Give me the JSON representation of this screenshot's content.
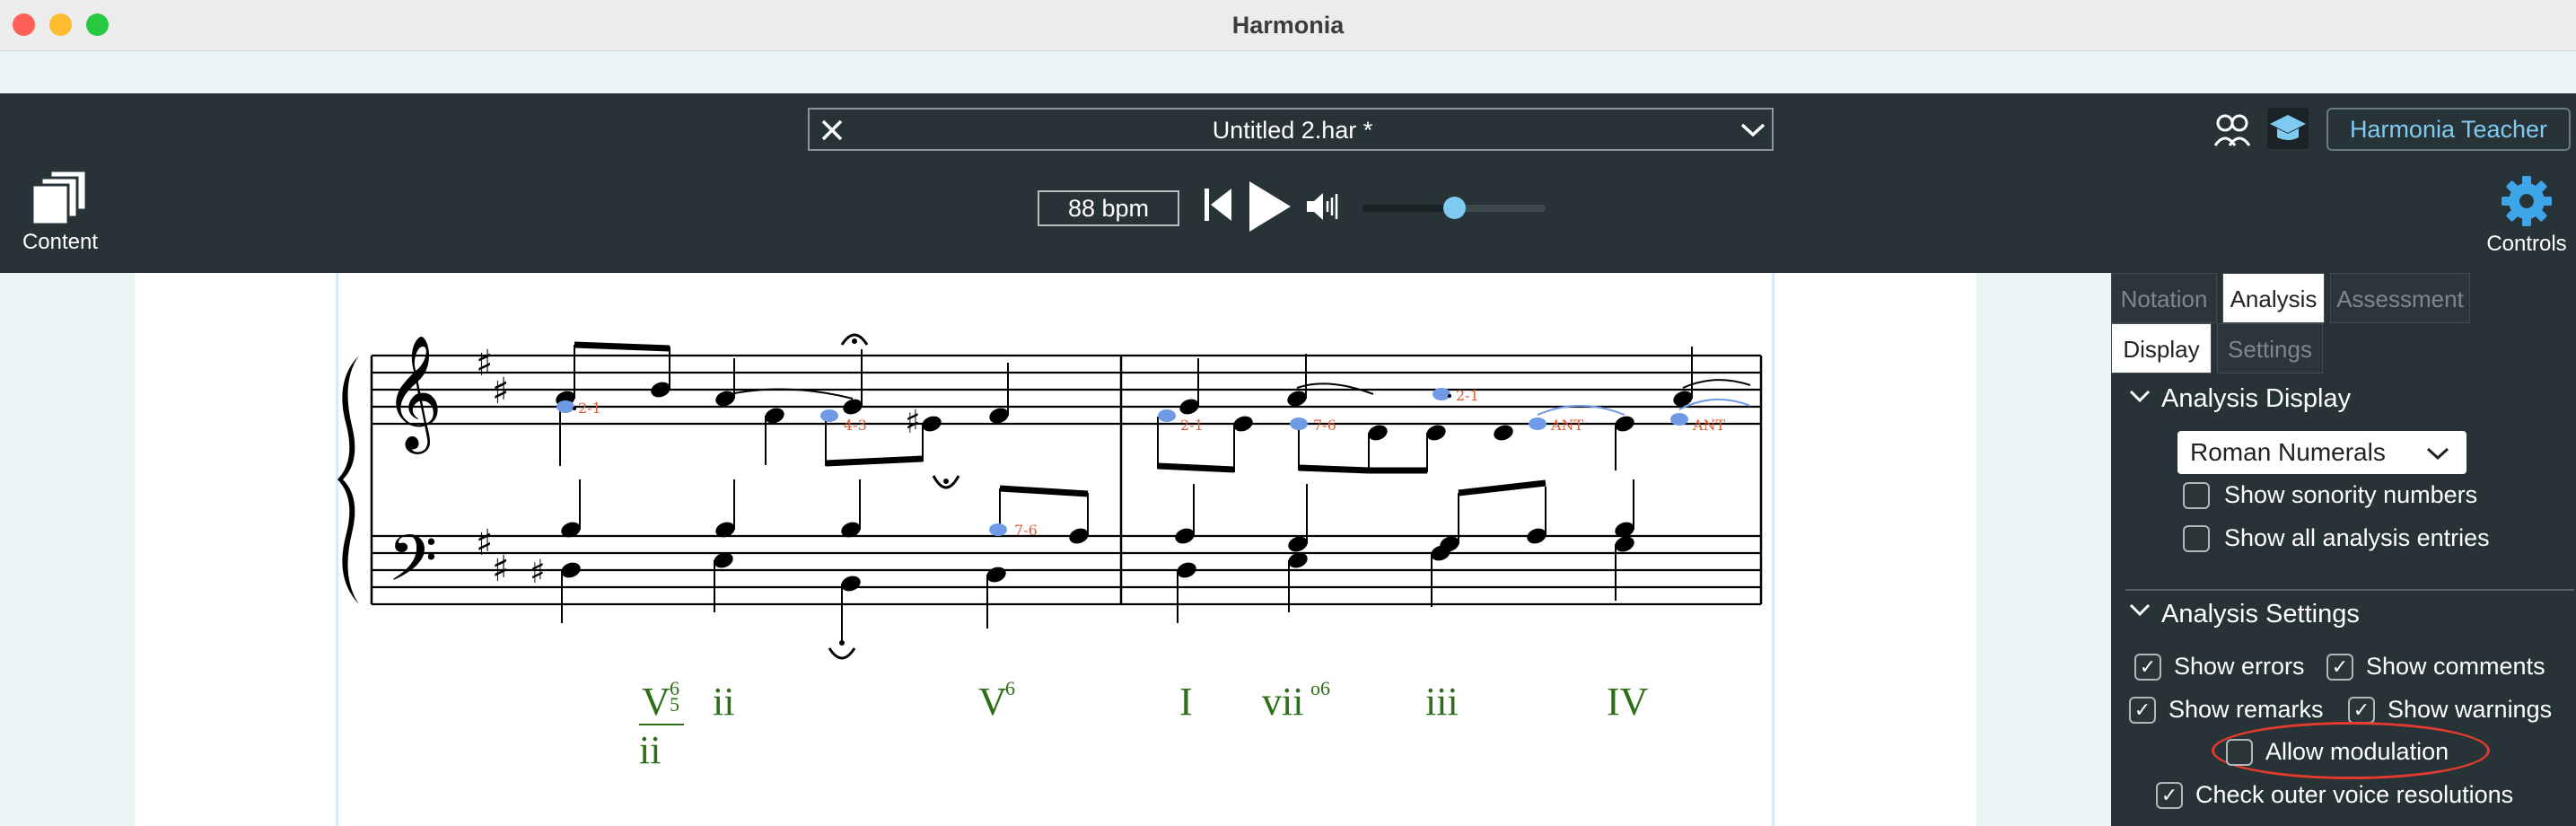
{
  "window": {
    "title": "Harmonia"
  },
  "toolbar": {
    "file_name": "Untitled 2.har *",
    "tempo": "88 bpm",
    "volume_level": 0.5,
    "content_label": "Content",
    "controls_label": "Controls",
    "teacher_label": "Harmonia Teacher"
  },
  "panel": {
    "tabs": [
      "Notation",
      "Analysis",
      "Assessment"
    ],
    "subtabs": [
      "Display",
      "Settings"
    ],
    "display_section_title": "Analysis Display",
    "dropdown_value": "Roman Numerals",
    "display_options": [
      {
        "label": "Show sonority numbers",
        "checked": false
      },
      {
        "label": "Show all analysis entries",
        "checked": false
      }
    ],
    "settings_section_title": "Analysis Settings",
    "settings_options": [
      {
        "label": "Show errors",
        "checked": true
      },
      {
        "label": "Show comments",
        "checked": true
      },
      {
        "label": "Show remarks",
        "checked": true
      },
      {
        "label": "Show warnings",
        "checked": true
      },
      {
        "label": "Allow modulation",
        "checked": false
      },
      {
        "label": "Check outer voice resolutions",
        "checked": true
      }
    ]
  },
  "score": {
    "roman_numerals": [
      "V",
      "ii",
      "V",
      "I",
      "vii",
      "iii",
      "IV"
    ],
    "secondary_denominator": "ii",
    "figures": {
      "V65_top": "6",
      "V65_bottom": "5",
      "V6": "6",
      "vii": "o6"
    },
    "annotations": [
      "2-1",
      "4-3",
      "7-6",
      "2-1",
      "7-6",
      "2-1",
      "ANT",
      "ANT"
    ],
    "colors": {
      "roman": "#2d6e17",
      "annotation": "#d9613a",
      "highlight": "#6f9be6"
    }
  }
}
